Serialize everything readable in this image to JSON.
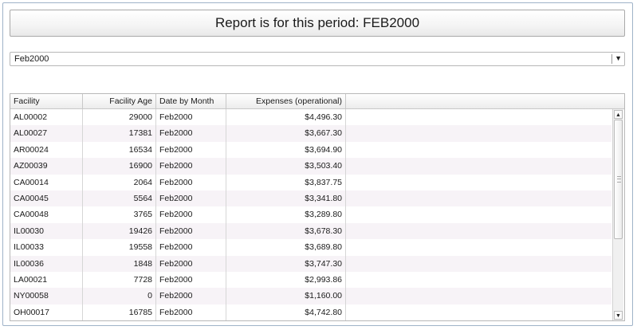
{
  "report": {
    "title": "Report is for this period: FEB2000"
  },
  "period_select": {
    "value": "Feb2000"
  },
  "table": {
    "columns": [
      "Facility",
      "Facility Age",
      "Date by Month",
      "Expenses (operational)",
      ""
    ],
    "rows": [
      [
        "AL00002",
        "29000",
        "Feb2000",
        "$4,496.30"
      ],
      [
        "AL00027",
        "17381",
        "Feb2000",
        "$3,667.30"
      ],
      [
        "AR00024",
        "16534",
        "Feb2000",
        "$3,694.90"
      ],
      [
        "AZ00039",
        "16900",
        "Feb2000",
        "$3,503.40"
      ],
      [
        "CA00014",
        "2064",
        "Feb2000",
        "$3,837.75"
      ],
      [
        "CA00045",
        "5564",
        "Feb2000",
        "$3,341.80"
      ],
      [
        "CA00048",
        "3765",
        "Feb2000",
        "$3,289.80"
      ],
      [
        "IL00030",
        "19426",
        "Feb2000",
        "$3,678.30"
      ],
      [
        "IL00033",
        "19558",
        "Feb2000",
        "$3,689.80"
      ],
      [
        "IL00036",
        "1848",
        "Feb2000",
        "$3,747.30"
      ],
      [
        "LA00021",
        "7728",
        "Feb2000",
        "$2,993.86"
      ],
      [
        "NY00058",
        "0",
        "Feb2000",
        "$1,160.00"
      ],
      [
        "OH00017",
        "16785",
        "Feb2000",
        "$4,742.80"
      ]
    ]
  },
  "icons": {
    "dropdown": "chevron-down-icon",
    "scroll_up": "arrow-up-icon",
    "scroll_down": "arrow-down-icon"
  }
}
